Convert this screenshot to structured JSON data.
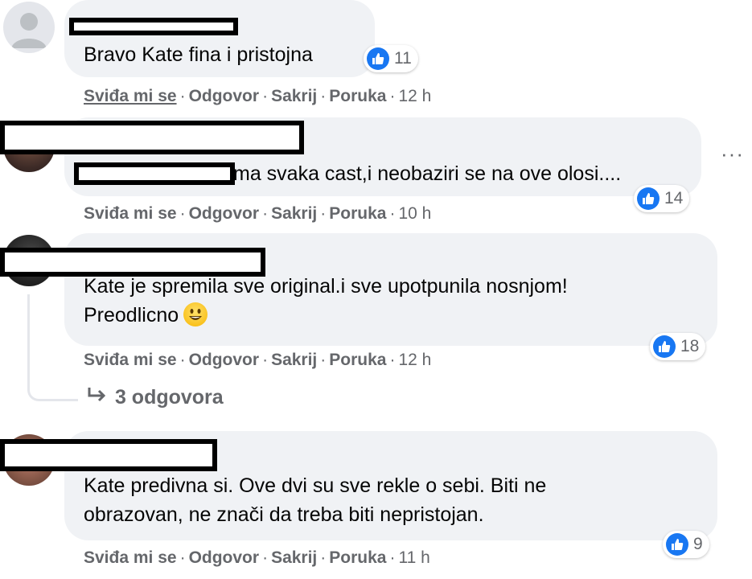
{
  "comments": [
    {
      "text": "Bravo Kate fina i pristojna",
      "reactions": "11",
      "actions": {
        "like": "Sviđa mi se",
        "reply": "Odgovor",
        "hide": "Sakrij",
        "message": "Poruka",
        "time": "12 h"
      }
    },
    {
      "text": "ma svaka cast,i neobaziri se na ove olosi....",
      "reactions": "14",
      "actions": {
        "like": "Sviđa mi se",
        "reply": "Odgovor",
        "hide": "Sakrij",
        "message": "Poruka",
        "time": "10 h"
      },
      "more": "···"
    },
    {
      "text_line1": "Kate je spremila sve original.i sve upotpunila nosnjom!",
      "text_line2": "Preodlicno",
      "reactions": "18",
      "actions": {
        "like": "Sviđa mi se",
        "reply": "Odgovor",
        "hide": "Sakrij",
        "message": "Poruka",
        "time": "12 h"
      },
      "replies": "3 odgovora"
    },
    {
      "text_line1": "Kate predivna si. Ove dvi su sve rekle o sebi. Biti ne",
      "text_line2": "obrazovan, ne znači da treba biti nepristojan.",
      "reactions": "9",
      "actions": {
        "like": "Sviđa mi se",
        "reply": "Odgovor",
        "hide": "Sakrij",
        "message": "Poruka",
        "time": "11 h"
      }
    }
  ],
  "colors": {
    "accent": "#1877f2",
    "bubble": "#f0f2f5",
    "meta": "#65676b"
  }
}
